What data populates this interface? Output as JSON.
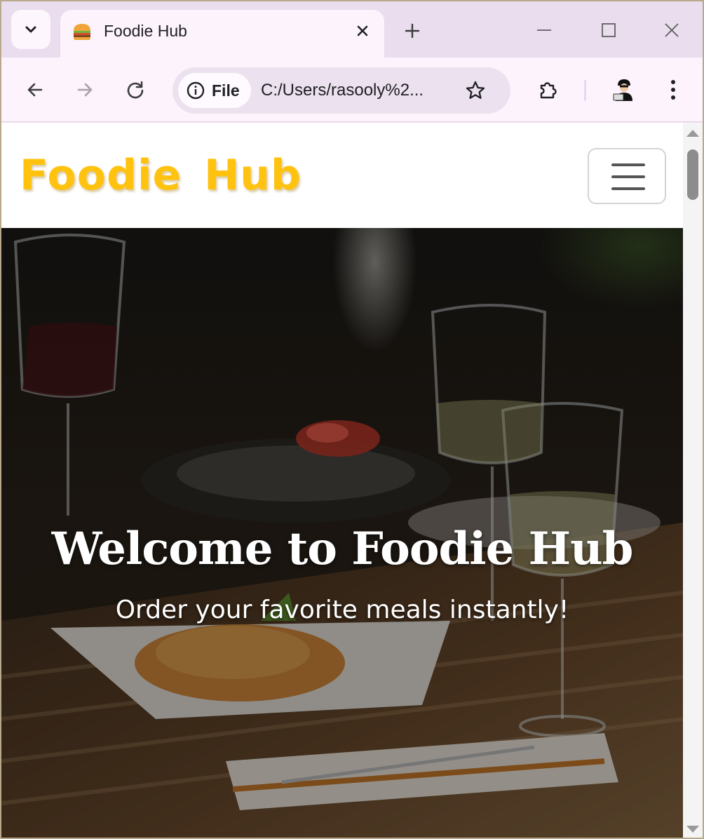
{
  "browser": {
    "tab": {
      "title": "Foodie Hub",
      "favicon": "burger-favicon"
    },
    "omnibox": {
      "site_chip_label": "File",
      "url": "C:/Users/rasooly%2..."
    },
    "icons": [
      "chevron-down-icon",
      "close-icon",
      "plus-icon",
      "minimize-icon",
      "maximize-icon",
      "back-arrow-icon",
      "forward-arrow-icon",
      "reload-icon",
      "info-icon",
      "star-icon",
      "extension-puzzle-icon",
      "profile-avatar",
      "more-vert-icon"
    ]
  },
  "site": {
    "brand": "Foodie Hub",
    "hero": {
      "title": "Welcome to Foodie Hub",
      "subtitle": "Order your favorite meals instantly!"
    }
  },
  "colors": {
    "brand": "#ffc20f",
    "chrome_bg": "#e9ddee",
    "tab_bg": "#fdf3fd"
  }
}
